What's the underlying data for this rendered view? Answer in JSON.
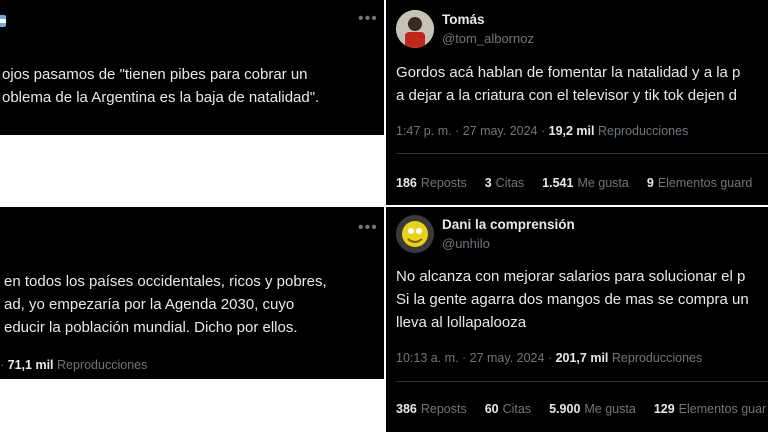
{
  "tweet1": {
    "lines": [
      "ojos pasamos de \"tienen pibes para cobrar un",
      "oblema de la Argentina es la baja de natalidad\"."
    ]
  },
  "tweet2": {
    "name": "Tomás",
    "handle": "@tom_albornoz",
    "lines": [
      "Gordos acá hablan de fomentar la natalidad y a la p",
      "a dejar a la criatura con el televisor y tik tok dejen d"
    ],
    "time": "1:47 p. m. · 27 may. 2024 · ",
    "views_count": "19,2 mil",
    "views_label": "Reproducciones",
    "stats": [
      {
        "num": "186",
        "label": "Reposts"
      },
      {
        "num": "3",
        "label": "Citas"
      },
      {
        "num": "1.541",
        "label": "Me gusta"
      },
      {
        "num": "9",
        "label": "Elementos guard"
      }
    ]
  },
  "tweet3": {
    "more": "•••",
    "lines": [
      "en todos los países occidentales, ricos y pobres,",
      "ad, yo empezaría por la Agenda 2030, cuyo",
      "educir la población mundial. Dicho por ellos."
    ],
    "views_prefix": "·",
    "views_count": "71,1 mil",
    "views_label": "Reproducciones"
  },
  "tweet4": {
    "name": "Dani la comprensión",
    "handle": "@unhilo",
    "lines": [
      "No alcanza con mejorar salarios para solucionar el p",
      "Si la gente agarra dos mangos de mas se compra un",
      "lleva al lollapalooza"
    ],
    "time": "10:13 a. m. · 27 may. 2024 · ",
    "views_count": "201,7 mil",
    "views_label": "Reproducciones",
    "stats": [
      {
        "num": "386",
        "label": "Reposts"
      },
      {
        "num": "60",
        "label": "Citas"
      },
      {
        "num": "5.900",
        "label": "Me gusta"
      },
      {
        "num": "129",
        "label": "Elementos guar"
      }
    ]
  },
  "more_icon": "•••"
}
